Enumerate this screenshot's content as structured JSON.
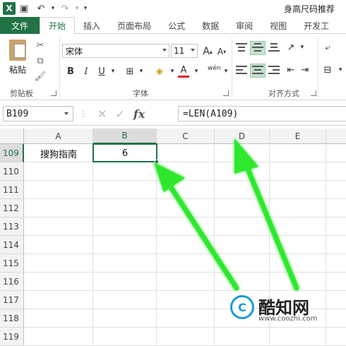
{
  "title_bar": {
    "app_icon": "X",
    "doc_title": "身高尺码推荐"
  },
  "tabs": [
    "文件",
    "开始",
    "插入",
    "页面布局",
    "公式",
    "数据",
    "审阅",
    "视图",
    "开发工"
  ],
  "active_tab": "开始",
  "ribbon": {
    "paste_label": "粘贴",
    "clipboard_group": "剪贴板",
    "font_group": "字体",
    "alignment_group": "对齐方式",
    "font_name": "宋体",
    "font_size": "11",
    "grow_font": "A",
    "shrink_font": "A",
    "bold": "B",
    "italic": "I",
    "underline": "U",
    "font_color_glyph": "A",
    "phonetic_glyph": "wén"
  },
  "formula_bar": {
    "name_box": "B109",
    "fx_label": "fx",
    "formula": "=LEN(A109)"
  },
  "columns": [
    "A",
    "B",
    "C",
    "D",
    "E"
  ],
  "selected_column": "B",
  "rows": [
    "109",
    "110",
    "111",
    "112",
    "113",
    "114",
    "115",
    "116",
    "117",
    "118",
    "119"
  ],
  "selected_row": "109",
  "cells": {
    "A109": "搜狗指南",
    "B109": "6"
  },
  "watermark": {
    "name": "酷知网",
    "url": "www.coozhi.com"
  },
  "colors": {
    "excel_green": "#217346",
    "arrow_green": "#2ee82e"
  }
}
